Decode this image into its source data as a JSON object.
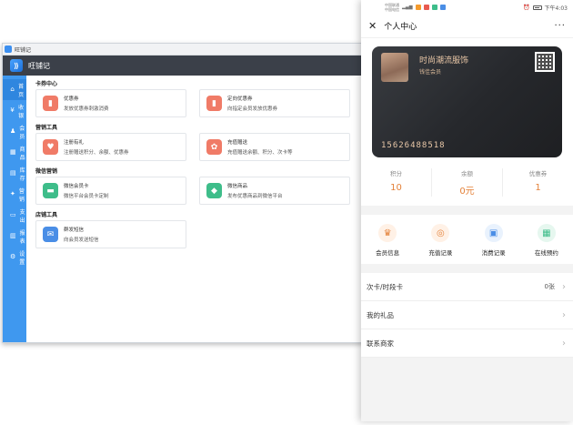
{
  "desktop": {
    "window_title": "旺铺记",
    "brand": "旺铺记",
    "sidebar": [
      {
        "icon": "home-icon",
        "label": "首页",
        "glyph": "⌂",
        "active": true
      },
      {
        "icon": "cashier-icon",
        "label": "收银",
        "glyph": "¥"
      },
      {
        "icon": "member-icon",
        "label": "会员",
        "glyph": "♟"
      },
      {
        "icon": "goods-icon",
        "label": "商品",
        "glyph": "▦"
      },
      {
        "icon": "stock-icon",
        "label": "库存",
        "glyph": "▤"
      },
      {
        "icon": "marketing-icon",
        "label": "营销",
        "glyph": "✦"
      },
      {
        "icon": "expense-icon",
        "label": "支出",
        "glyph": "▭"
      },
      {
        "icon": "report-icon",
        "label": "报表",
        "glyph": "▥"
      },
      {
        "icon": "settings-icon",
        "label": "设置",
        "glyph": "⚙"
      }
    ],
    "sections": [
      {
        "title": "卡券中心",
        "cards": [
          {
            "icon": "coupon-icon",
            "glyph": "▮",
            "color": "#f07b67",
            "title": "优惠券",
            "desc": "发放优惠券刺激消费"
          },
          {
            "icon": "target-coupon-icon",
            "glyph": "▮",
            "color": "#f07b67",
            "title": "定向优惠券",
            "desc": "向指定会员发放优惠券"
          }
        ]
      },
      {
        "title": "营销工具",
        "cards": [
          {
            "icon": "register-gift-icon",
            "glyph": "♥",
            "color": "#f07b67",
            "title": "注册有礼",
            "desc": "注册赠送积分、余额、优惠券"
          },
          {
            "icon": "recharge-gift-icon",
            "glyph": "✿",
            "color": "#f07b67",
            "title": "充值赠送",
            "desc": "充值赠送余额、积分、次卡等"
          }
        ]
      },
      {
        "title": "微信营销",
        "cards": [
          {
            "icon": "wechat-card-icon",
            "glyph": "▬",
            "color": "#3ebd8a",
            "title": "微信会员卡",
            "desc": "微信平台会员卡定制"
          },
          {
            "icon": "wechat-goods-icon",
            "glyph": "◆",
            "color": "#3ebd8a",
            "title": "微信商品",
            "desc": "发布优惠商品到微信平台"
          }
        ]
      },
      {
        "title": "店铺工具",
        "cards": [
          {
            "icon": "sms-icon",
            "glyph": "✉",
            "color": "#4a8ee6",
            "title": "群发短信",
            "desc": "向会员发送短信"
          }
        ]
      }
    ]
  },
  "phone": {
    "status": {
      "carrier1": "中国联通",
      "carrier2": "中国电信",
      "time": "下午4:03"
    },
    "title": "个人中心",
    "close_glyph": "✕",
    "more_glyph": "···",
    "card": {
      "shop_name": "时尚潮流服饰",
      "level": "钱佳会员",
      "number": "15626488518"
    },
    "stats": [
      {
        "label": "积分",
        "value": "10"
      },
      {
        "label": "余额",
        "value": "0元"
      },
      {
        "label": "优惠券",
        "value": "1"
      }
    ],
    "actions": [
      {
        "icon": "crown-icon",
        "glyph": "♛",
        "color": "#e4823a",
        "bg": "#fff1e6",
        "label": "会员信息"
      },
      {
        "icon": "coins-icon",
        "glyph": "◎",
        "color": "#e4823a",
        "bg": "#fff1e6",
        "label": "充值记录"
      },
      {
        "icon": "receipt-icon",
        "glyph": "▣",
        "color": "#4a8ee6",
        "bg": "#e9f2fd",
        "label": "消费记录"
      },
      {
        "icon": "calendar-icon",
        "glyph": "▦",
        "color": "#3ebd8a",
        "bg": "#e6f7ef",
        "label": "在线预约"
      }
    ],
    "menu": [
      {
        "label": "次卡/时段卡",
        "value": "0张"
      },
      {
        "label": "我的礼品",
        "value": ""
      },
      {
        "label": "联系商家",
        "value": ""
      }
    ],
    "chevron": "›"
  }
}
